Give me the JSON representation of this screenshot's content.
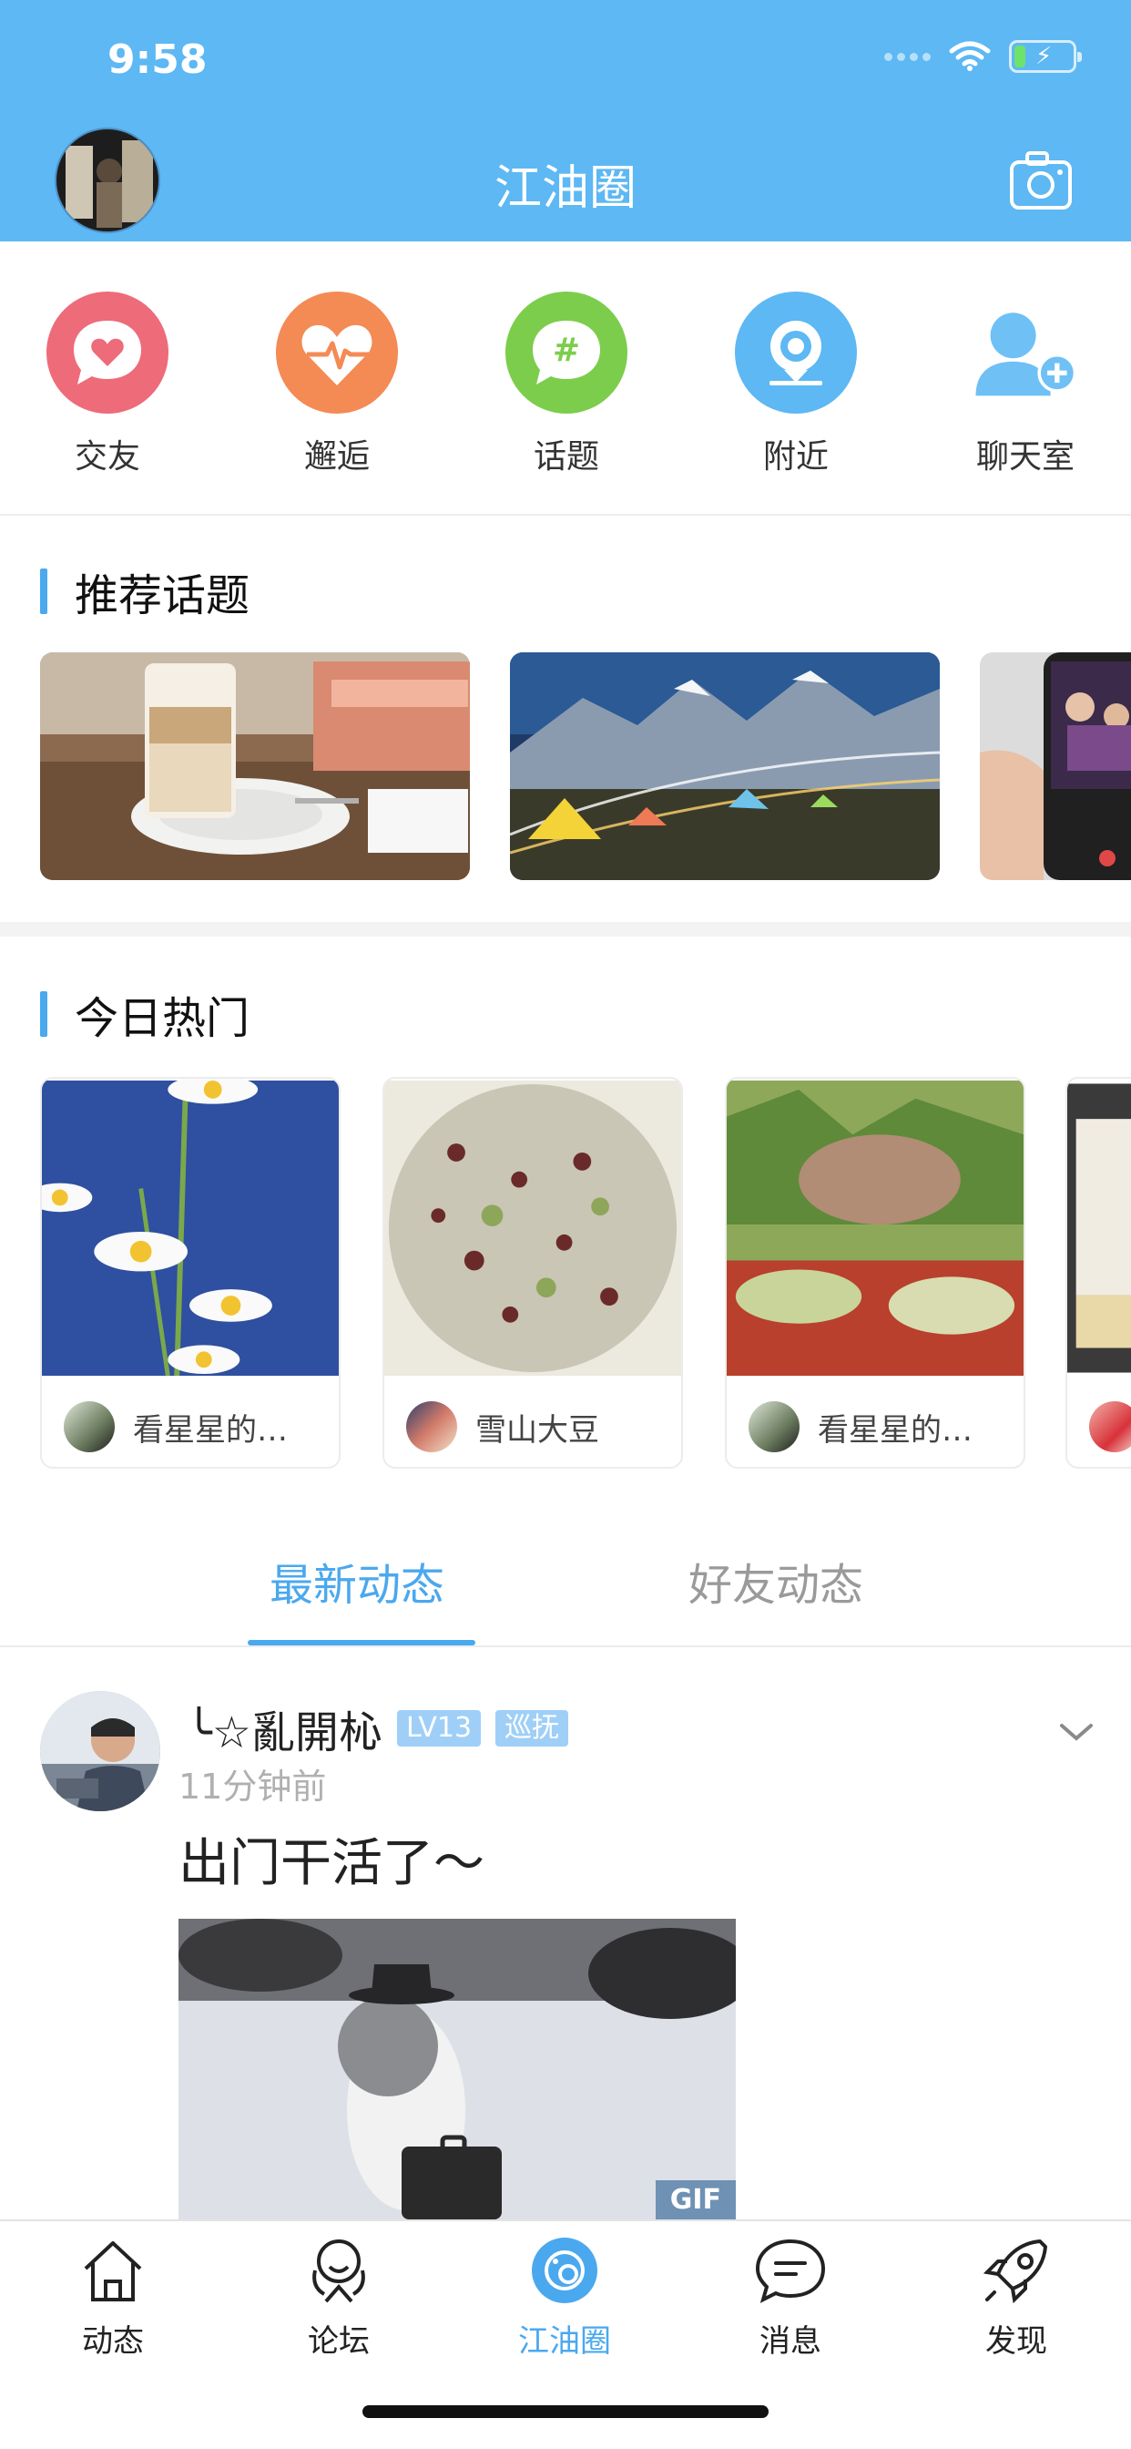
{
  "status_bar": {
    "time": "9:58"
  },
  "header": {
    "title": "江油圈"
  },
  "shortcuts": [
    {
      "label": "交友",
      "icon": "heart-chat-icon",
      "color": "#ee6b7a"
    },
    {
      "label": "邂逅",
      "icon": "heartbeat-icon",
      "color": "#f48a54"
    },
    {
      "label": "话题",
      "icon": "hashtag-chat-icon",
      "color": "#7ccd4c"
    },
    {
      "label": "附近",
      "icon": "location-pin-icon",
      "color": "#5db8f3"
    },
    {
      "label": "聊天室",
      "icon": "add-user-icon",
      "color": "#5db8f3"
    }
  ],
  "recommended": {
    "title": "推荐话题"
  },
  "hot": {
    "title": "今日热门",
    "items": [
      {
        "name": "看星星的…"
      },
      {
        "name": "雪山大豆"
      },
      {
        "name": "看星星的…"
      }
    ]
  },
  "tabs": {
    "latest": "最新动态",
    "friends": "好友动态"
  },
  "post": {
    "username": "╰☆亂開杺",
    "level": "LV13",
    "role": "巡抚",
    "time": "11分钟前",
    "text": "出门干活了～",
    "gif_label": "GIF"
  },
  "bottom_nav": [
    {
      "label": "动态",
      "icon": "home-icon"
    },
    {
      "label": "论坛",
      "icon": "forum-icon"
    },
    {
      "label": "江油圈",
      "icon": "circle-camera-icon"
    },
    {
      "label": "消息",
      "icon": "message-icon"
    },
    {
      "label": "发现",
      "icon": "rocket-icon"
    }
  ],
  "colors": {
    "brand": "#5db8f3",
    "accent": "#4aa8ee"
  }
}
